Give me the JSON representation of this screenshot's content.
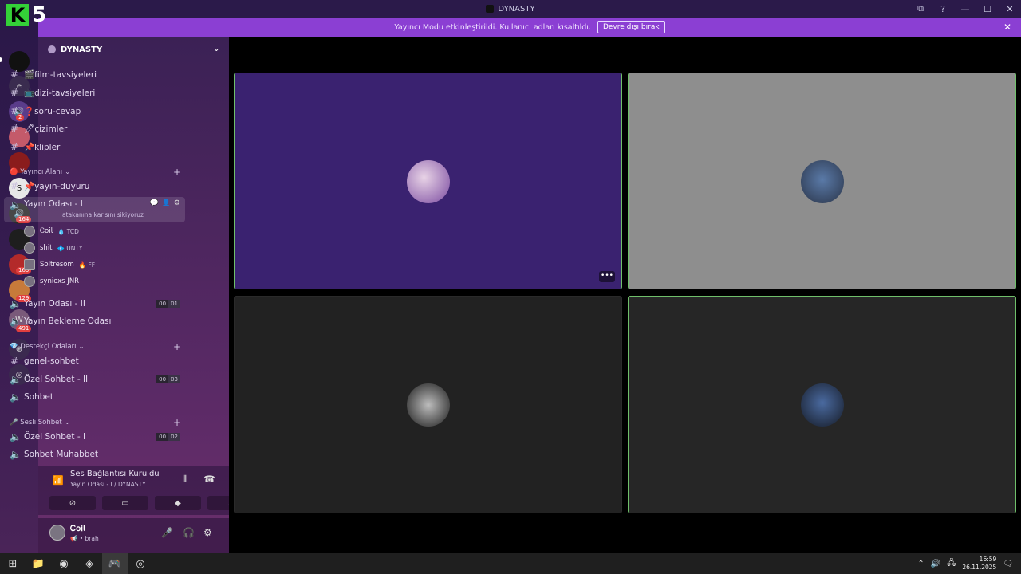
{
  "window": {
    "title": "DYNASTY"
  },
  "logo": {
    "letter": "K",
    "number": "5"
  },
  "banner": {
    "message": "Yayıncı Modu etkinleştirildi. Kullanıcı adları kısaltıldı.",
    "button": "Devre dışı bırak"
  },
  "rail": {
    "letter_server": "e",
    "badges": [
      "2",
      "164",
      "165",
      "129",
      "491"
    ]
  },
  "server": {
    "name": "DYNASTY"
  },
  "channels_top": [
    {
      "name": "🎬film-tavsiyeleri"
    },
    {
      "name": "📺dizi-tavsiyeleri"
    },
    {
      "name": "❓soru-cevap"
    },
    {
      "name": "🖊çizimler"
    },
    {
      "name": "📌klipler"
    }
  ],
  "categories": {
    "yayinci": "🔴 Yayıncı Alanı",
    "destekci": "💎 Destekçi Odaları",
    "sesli": "🎤 Sesli Sohbet"
  },
  "yayinci_channels": {
    "duyuru": "📌yayın-duyuru",
    "oda1": "Yayın Odası - I",
    "oda1_status": "atakanına karısını sikiyoruz",
    "oda2": "Yayın Odası - II",
    "oda2_count": [
      "00",
      "01"
    ],
    "bekleme": "Yayın Bekleme Odası"
  },
  "members": [
    {
      "name": "Ꮯ𝗈𝗂𝗅",
      "tag": "💧 TCD"
    },
    {
      "name": "shit",
      "tag": "💠 UNTY"
    },
    {
      "name": "Soltresom",
      "tag": "🔥 FF"
    },
    {
      "name": "synioxs JNR",
      "tag": ""
    }
  ],
  "destekci_channels": {
    "genel": "genel-sohbet",
    "ozel2": "Özel Sohbet - II",
    "ozel2_count": [
      "00",
      "03"
    ],
    "sohbet": "Sohbet"
  },
  "sesli_channels": {
    "ozel1": "Özel Sohbet - I",
    "ozel1_count": [
      "00",
      "02"
    ],
    "muhabbet": "Sohbet Muhabbet"
  },
  "voice": {
    "status": "Ses Bağlantısı Kuruldu",
    "location": "Yayın Odası - I / DYNASTY"
  },
  "user": {
    "name": "Ꮯ𝗈𝗂𝗅",
    "status": "📢 • brah"
  },
  "tiles": [
    {
      "color": "#3a2270",
      "border": "#6fbf6a"
    },
    {
      "color": "#8e8e8e",
      "border": "#6fbf6a"
    },
    {
      "color": "#222222",
      "border": "#2a2a2a"
    },
    {
      "color": "#262626",
      "border": "#6fbf6a"
    }
  ],
  "taskbar": {
    "time": "16:59",
    "date": "26.11.2025"
  }
}
